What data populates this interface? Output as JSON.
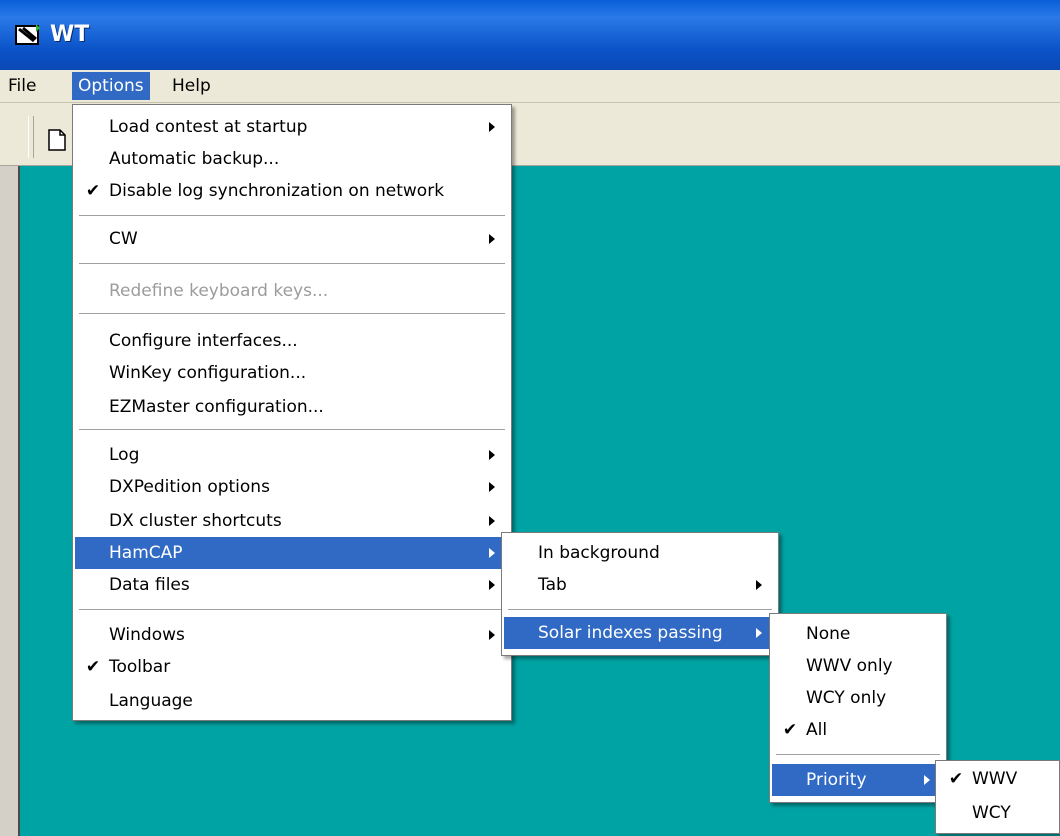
{
  "window": {
    "title": "WT"
  },
  "menubar": {
    "items": [
      "File",
      "Options",
      "Help"
    ]
  },
  "options_menu": {
    "items": [
      {
        "label": "Load contest at startup",
        "submenu": true
      },
      {
        "label": "Automatic backup..."
      },
      {
        "label": "Disable log synchronization on network",
        "checked": true
      },
      {
        "label": "CW",
        "submenu": true
      },
      {
        "label": "Redefine keyboard keys...",
        "disabled": true
      },
      {
        "label": "Configure interfaces..."
      },
      {
        "label": "WinKey configuration..."
      },
      {
        "label": "EZMaster configuration..."
      },
      {
        "label": "Log",
        "submenu": true
      },
      {
        "label": "DXPedition options",
        "submenu": true
      },
      {
        "label": "DX cluster shortcuts",
        "submenu": true
      },
      {
        "label": "HamCAP",
        "submenu": true,
        "highlighted": true
      },
      {
        "label": "Data files",
        "submenu": true
      },
      {
        "label": "Windows",
        "submenu": true
      },
      {
        "label": "Toolbar",
        "checked": true
      },
      {
        "label": "Language"
      }
    ]
  },
  "hamcap_menu": {
    "items": [
      {
        "label": "In background"
      },
      {
        "label": "Tab",
        "submenu": true
      },
      {
        "label": "Solar indexes passing",
        "submenu": true,
        "highlighted": true
      }
    ]
  },
  "solar_menu": {
    "items": [
      {
        "label": "None"
      },
      {
        "label": "WWV only"
      },
      {
        "label": "WCY only"
      },
      {
        "label": "All",
        "checked": true
      },
      {
        "label": "Priority",
        "submenu": true,
        "highlighted": true
      }
    ]
  },
  "priority_menu": {
    "items": [
      {
        "label": "WWV",
        "checked": true
      },
      {
        "label": "WCY"
      }
    ]
  },
  "glyphs": {
    "check": "✔"
  },
  "colors": {
    "highlight": "#316ac5",
    "client_bg": "#00a3a3",
    "titlebar": "#0a5fd8"
  }
}
